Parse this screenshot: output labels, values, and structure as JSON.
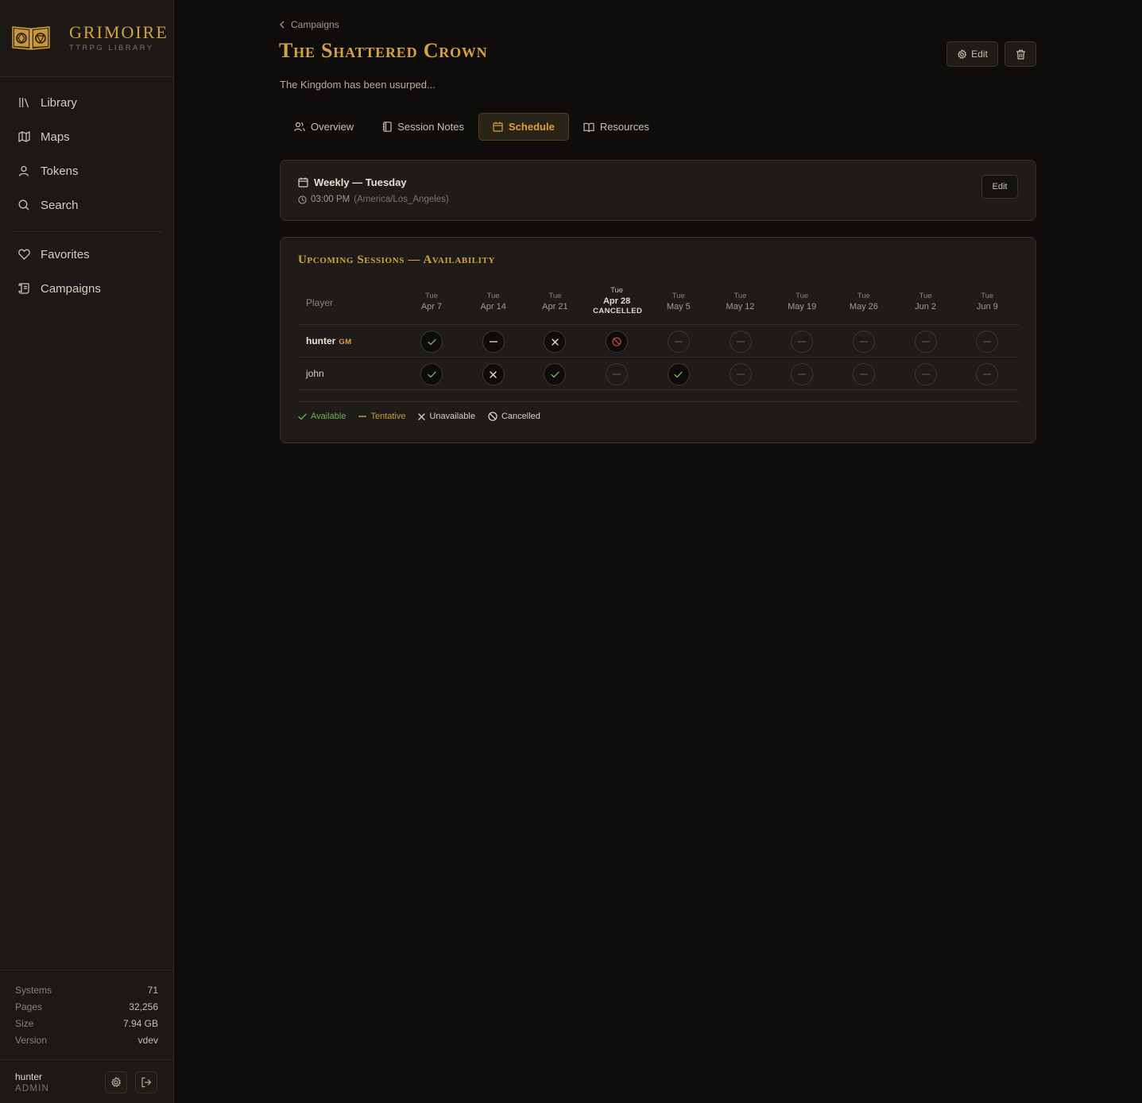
{
  "brand": {
    "name": "GRIMOIRE",
    "subtitle": "TTRPG LIBRARY"
  },
  "nav": {
    "items": [
      {
        "label": "Library",
        "icon": "library-icon"
      },
      {
        "label": "Maps",
        "icon": "map-icon"
      },
      {
        "label": "Tokens",
        "icon": "user-icon"
      },
      {
        "label": "Search",
        "icon": "search-icon"
      }
    ],
    "secondary": [
      {
        "label": "Favorites",
        "icon": "heart-icon"
      },
      {
        "label": "Campaigns",
        "icon": "scroll-icon"
      }
    ]
  },
  "stats": [
    {
      "label": "Systems",
      "value": "71"
    },
    {
      "label": "Pages",
      "value": "32,256"
    },
    {
      "label": "Size",
      "value": "7.94 GB"
    },
    {
      "label": "Version",
      "value": "vdev"
    }
  ],
  "user": {
    "name": "hunter",
    "role": "ADMIN"
  },
  "breadcrumb": {
    "label": "Campaigns"
  },
  "campaign": {
    "title": "The Shattered Crown",
    "description": "The Kingdom has been usurped..."
  },
  "header_buttons": {
    "edit_label": "Edit"
  },
  "tabs": [
    {
      "label": "Overview",
      "icon": "users-icon",
      "active": false
    },
    {
      "label": "Session Notes",
      "icon": "notebook-icon",
      "active": false
    },
    {
      "label": "Schedule",
      "icon": "calendar-icon",
      "active": true
    },
    {
      "label": "Resources",
      "icon": "book-open-icon",
      "active": false
    }
  ],
  "schedule": {
    "title": "Weekly — Tuesday",
    "time": "03:00 PM",
    "timezone": "(America/Los_Angeles)",
    "edit_label": "Edit"
  },
  "availability": {
    "title": "Upcoming Sessions — Availability",
    "player_header": "Player",
    "dates": [
      {
        "dow": "Tue",
        "date": "Apr 7",
        "cancelled": false
      },
      {
        "dow": "Tue",
        "date": "Apr 14",
        "cancelled": false
      },
      {
        "dow": "Tue",
        "date": "Apr 21",
        "cancelled": false
      },
      {
        "dow": "Tue",
        "date": "Apr 28",
        "cancelled": true,
        "cancel_label": "CANCELLED"
      },
      {
        "dow": "Tue",
        "date": "May 5",
        "cancelled": false
      },
      {
        "dow": "Tue",
        "date": "May 12",
        "cancelled": false
      },
      {
        "dow": "Tue",
        "date": "May 19",
        "cancelled": false
      },
      {
        "dow": "Tue",
        "date": "May 26",
        "cancelled": false
      },
      {
        "dow": "Tue",
        "date": "Jun 2",
        "cancelled": false
      },
      {
        "dow": "Tue",
        "date": "Jun 9",
        "cancelled": false
      }
    ],
    "players": [
      {
        "name": "hunter",
        "badge": "GM",
        "statuses": [
          "available",
          "tentative",
          "unavailable",
          "cancelled",
          "none",
          "none",
          "none",
          "none",
          "none",
          "none"
        ]
      },
      {
        "name": "john",
        "badge": "",
        "statuses": [
          "available",
          "unavailable",
          "available",
          "none",
          "available",
          "none",
          "none",
          "none",
          "none",
          "none"
        ]
      }
    ],
    "legend": [
      {
        "key": "available",
        "label": "Available",
        "color": "#6fae5a"
      },
      {
        "key": "tentative",
        "label": "Tentative",
        "color": "#c89a3c"
      },
      {
        "key": "unavailable",
        "label": "Unavailable",
        "color": "#d8d0c2"
      },
      {
        "key": "cancelled",
        "label": "Cancelled",
        "color": "#d8d0c2"
      }
    ]
  },
  "colors": {
    "accent": "#d4a23e",
    "available": "#6fae5a",
    "cancelled": "#c8453c"
  }
}
